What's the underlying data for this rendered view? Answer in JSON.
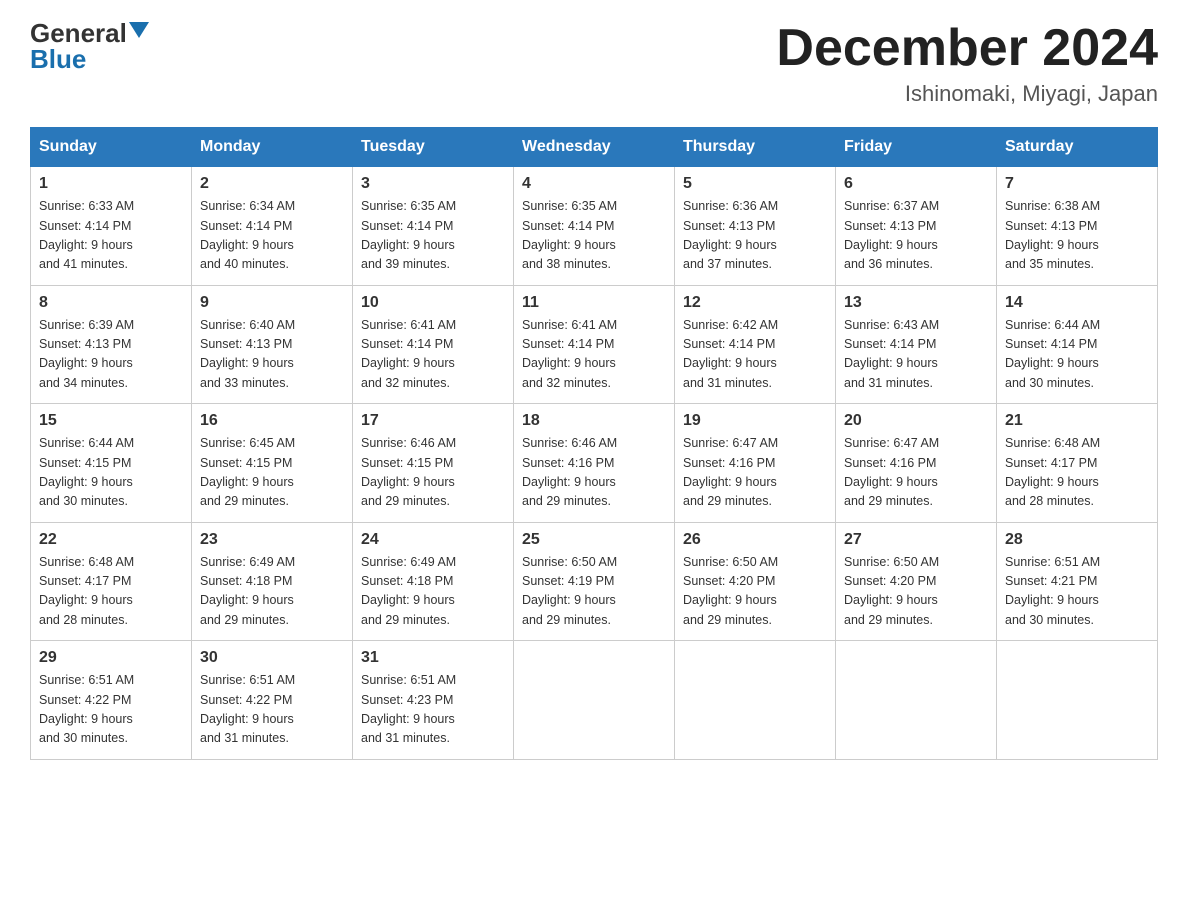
{
  "logo": {
    "general": "General",
    "blue": "Blue"
  },
  "title": {
    "month_year": "December 2024",
    "location": "Ishinomaki, Miyagi, Japan"
  },
  "weekdays": [
    "Sunday",
    "Monday",
    "Tuesday",
    "Wednesday",
    "Thursday",
    "Friday",
    "Saturday"
  ],
  "weeks": [
    [
      {
        "day": "1",
        "sunrise": "6:33 AM",
        "sunset": "4:14 PM",
        "daylight": "9 hours and 41 minutes."
      },
      {
        "day": "2",
        "sunrise": "6:34 AM",
        "sunset": "4:14 PM",
        "daylight": "9 hours and 40 minutes."
      },
      {
        "day": "3",
        "sunrise": "6:35 AM",
        "sunset": "4:14 PM",
        "daylight": "9 hours and 39 minutes."
      },
      {
        "day": "4",
        "sunrise": "6:35 AM",
        "sunset": "4:14 PM",
        "daylight": "9 hours and 38 minutes."
      },
      {
        "day": "5",
        "sunrise": "6:36 AM",
        "sunset": "4:13 PM",
        "daylight": "9 hours and 37 minutes."
      },
      {
        "day": "6",
        "sunrise": "6:37 AM",
        "sunset": "4:13 PM",
        "daylight": "9 hours and 36 minutes."
      },
      {
        "day": "7",
        "sunrise": "6:38 AM",
        "sunset": "4:13 PM",
        "daylight": "9 hours and 35 minutes."
      }
    ],
    [
      {
        "day": "8",
        "sunrise": "6:39 AM",
        "sunset": "4:13 PM",
        "daylight": "9 hours and 34 minutes."
      },
      {
        "day": "9",
        "sunrise": "6:40 AM",
        "sunset": "4:13 PM",
        "daylight": "9 hours and 33 minutes."
      },
      {
        "day": "10",
        "sunrise": "6:41 AM",
        "sunset": "4:14 PM",
        "daylight": "9 hours and 32 minutes."
      },
      {
        "day": "11",
        "sunrise": "6:41 AM",
        "sunset": "4:14 PM",
        "daylight": "9 hours and 32 minutes."
      },
      {
        "day": "12",
        "sunrise": "6:42 AM",
        "sunset": "4:14 PM",
        "daylight": "9 hours and 31 minutes."
      },
      {
        "day": "13",
        "sunrise": "6:43 AM",
        "sunset": "4:14 PM",
        "daylight": "9 hours and 31 minutes."
      },
      {
        "day": "14",
        "sunrise": "6:44 AM",
        "sunset": "4:14 PM",
        "daylight": "9 hours and 30 minutes."
      }
    ],
    [
      {
        "day": "15",
        "sunrise": "6:44 AM",
        "sunset": "4:15 PM",
        "daylight": "9 hours and 30 minutes."
      },
      {
        "day": "16",
        "sunrise": "6:45 AM",
        "sunset": "4:15 PM",
        "daylight": "9 hours and 29 minutes."
      },
      {
        "day": "17",
        "sunrise": "6:46 AM",
        "sunset": "4:15 PM",
        "daylight": "9 hours and 29 minutes."
      },
      {
        "day": "18",
        "sunrise": "6:46 AM",
        "sunset": "4:16 PM",
        "daylight": "9 hours and 29 minutes."
      },
      {
        "day": "19",
        "sunrise": "6:47 AM",
        "sunset": "4:16 PM",
        "daylight": "9 hours and 29 minutes."
      },
      {
        "day": "20",
        "sunrise": "6:47 AM",
        "sunset": "4:16 PM",
        "daylight": "9 hours and 29 minutes."
      },
      {
        "day": "21",
        "sunrise": "6:48 AM",
        "sunset": "4:17 PM",
        "daylight": "9 hours and 28 minutes."
      }
    ],
    [
      {
        "day": "22",
        "sunrise": "6:48 AM",
        "sunset": "4:17 PM",
        "daylight": "9 hours and 28 minutes."
      },
      {
        "day": "23",
        "sunrise": "6:49 AM",
        "sunset": "4:18 PM",
        "daylight": "9 hours and 29 minutes."
      },
      {
        "day": "24",
        "sunrise": "6:49 AM",
        "sunset": "4:18 PM",
        "daylight": "9 hours and 29 minutes."
      },
      {
        "day": "25",
        "sunrise": "6:50 AM",
        "sunset": "4:19 PM",
        "daylight": "9 hours and 29 minutes."
      },
      {
        "day": "26",
        "sunrise": "6:50 AM",
        "sunset": "4:20 PM",
        "daylight": "9 hours and 29 minutes."
      },
      {
        "day": "27",
        "sunrise": "6:50 AM",
        "sunset": "4:20 PM",
        "daylight": "9 hours and 29 minutes."
      },
      {
        "day": "28",
        "sunrise": "6:51 AM",
        "sunset": "4:21 PM",
        "daylight": "9 hours and 30 minutes."
      }
    ],
    [
      {
        "day": "29",
        "sunrise": "6:51 AM",
        "sunset": "4:22 PM",
        "daylight": "9 hours and 30 minutes."
      },
      {
        "day": "30",
        "sunrise": "6:51 AM",
        "sunset": "4:22 PM",
        "daylight": "9 hours and 31 minutes."
      },
      {
        "day": "31",
        "sunrise": "6:51 AM",
        "sunset": "4:23 PM",
        "daylight": "9 hours and 31 minutes."
      },
      null,
      null,
      null,
      null
    ]
  ]
}
